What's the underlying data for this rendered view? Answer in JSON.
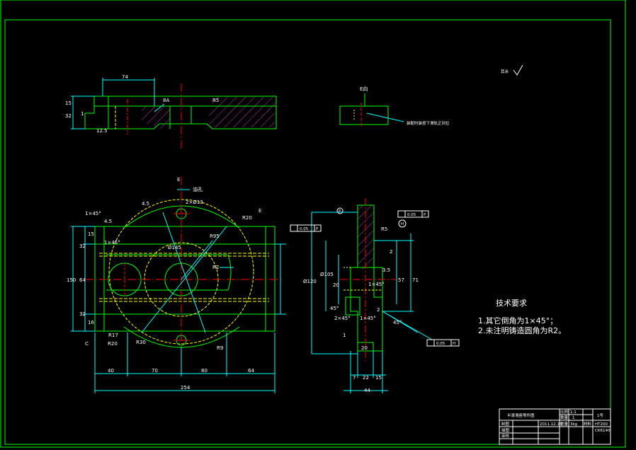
{
  "colors": {
    "background": "#000000",
    "frame": "#00ff00",
    "outline": "#00ff00",
    "dimension": "#00ffff",
    "centerline": "#ff0000",
    "hidden": "#ffff00",
    "hatch": "#cc33cc",
    "text": "#ffffff"
  },
  "top_view": {
    "dims": {
      "width_74": "74",
      "h15": "15",
      "h32": "32",
      "h1": "1",
      "ra": "8A",
      "r35": "R5",
      "c13": "12.5"
    }
  },
  "section_note": {
    "label": "E向",
    "note": "装配时装按下滑轨正到位"
  },
  "roughness_note": {
    "text": "其余"
  },
  "main_view": {
    "labels": {
      "marker": "E",
      "hole_label": "2×Ø13",
      "annot_top": "油孔",
      "r20_top": "R20",
      "r95": "R95",
      "r9": "R9",
      "r2": "R2",
      "r30": "R30",
      "r20_bot": "R20",
      "r17": "R17",
      "c45_left": "1×45°",
      "c45_top": "1×45°",
      "a5": "4.5",
      "a1": "4.5",
      "l12": "12",
      "l2": "2",
      "c": "C",
      "e": "E",
      "r145": "Ø145"
    },
    "dims": {
      "d40": "40",
      "d70": "70",
      "d80": "80",
      "d64": "64",
      "d254": "254",
      "v32a": "32",
      "v32b": "32",
      "v64": "64",
      "v150": "150",
      "v15": "15",
      "v16": "16"
    }
  },
  "side_view": {
    "labels": {
      "tol1": "0.05",
      "tol1_ref": "P",
      "tol2": "0.05",
      "tol2_ref": "P",
      "tol3": "0.05",
      "tol3_ref": "H",
      "marker_a": "P",
      "marker_b": "H",
      "r5": "R5",
      "c145": "1×45°",
      "c245": "2×45°",
      "c1": "1×45°",
      "ang": "45°",
      "d120": "Ø120",
      "d105": "Ø105",
      "d20": "20",
      "h2": "2",
      "h57": "57",
      "h71": "71",
      "h35": "3.5",
      "h2b": "2",
      "w7": "7",
      "w22": "22",
      "w15": "15",
      "w44": "44",
      "w20": "20",
      "r45": "45°",
      "r1": "1"
    }
  },
  "tech_requirements": {
    "title": "技术要求",
    "items": [
      "1.其它倒角为1×45°；",
      "2.未注明铸造圆角为R2。"
    ]
  },
  "title_block": {
    "part_name": "半滚滑座零件图",
    "scale_label": "比例",
    "scale_value": "1:1",
    "material_label": "材料",
    "material_value": "HT200",
    "qty_label": "数量",
    "qty_value": "1",
    "weight_label": "重量",
    "weight_value": "3kg",
    "drawing_no": "1号",
    "code": "CK6140",
    "row1": "制图",
    "row2": "描图",
    "row3": "审核",
    "date": "2011.12.15"
  }
}
